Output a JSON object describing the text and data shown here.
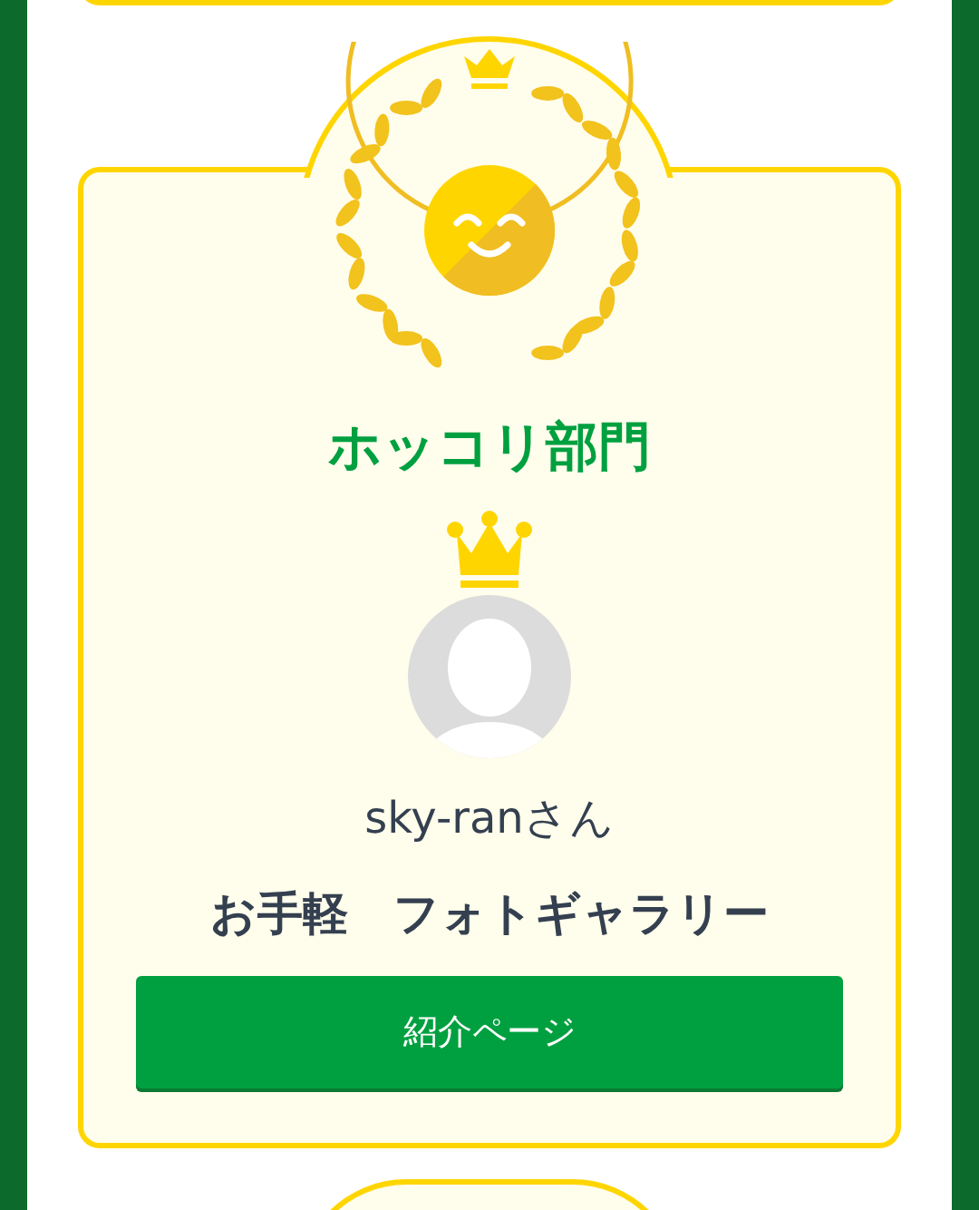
{
  "section": {
    "title": "ホッコリ部門"
  },
  "winner": {
    "name": "sky-ranさん",
    "work": "お手軽　フォトギャラリー",
    "button": "紹介ページ"
  }
}
